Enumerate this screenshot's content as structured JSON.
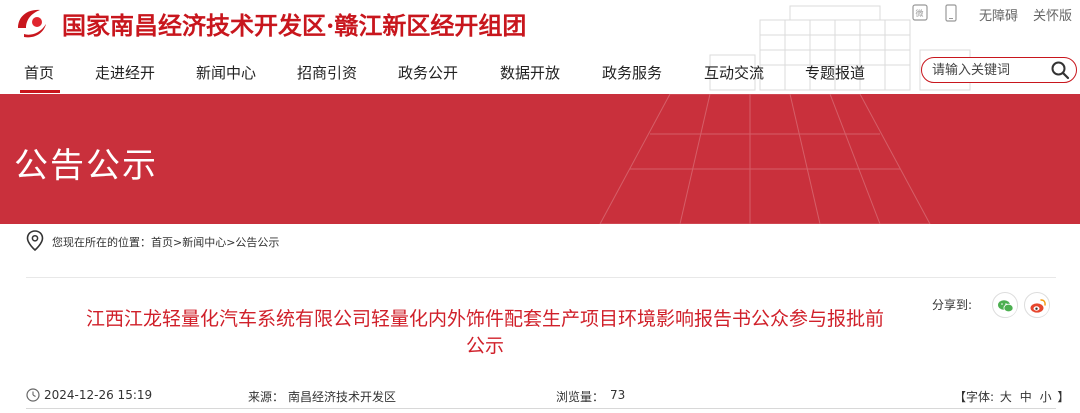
{
  "header": {
    "site_title": "国家南昌经济技术开发区·赣江新区经开组团",
    "utilities": [
      "无障碍",
      "关怀版"
    ],
    "brand_color": "#c8161d",
    "icons": [
      "logo-mark-icon",
      "wechat-qr-icon",
      "mobile-icon"
    ]
  },
  "nav": {
    "items": [
      "首页",
      "走进经开",
      "新闻中心",
      "招商引资",
      "政务公开",
      "数据开放",
      "政务服务",
      "互动交流",
      "专题报道"
    ],
    "active": "首页"
  },
  "search": {
    "placeholder": "请输入关键词",
    "icon": "search-icon"
  },
  "banner": {
    "title": "公告公示",
    "background": "#c9303c"
  },
  "breadcrumb": {
    "icon": "location-pin-icon",
    "text": "您现在所在的位置：首页>新闻中心>公告公示"
  },
  "article": {
    "title_line1": "江西江龙轻量化汽车系统有限公司轻量化内外饰件配套生产项目环境影响报告书公众参与报批前",
    "title_line2": "公示",
    "title_color": "#d0202a",
    "share_label": "分享到:",
    "share_icons": [
      "wechat-share-icon",
      "weibo-share-icon"
    ],
    "date": "2024-12-26 15:19",
    "source_label": "来源：",
    "source": "南昌经济技术开发区",
    "views_label": "浏览量：",
    "views": "73",
    "font_label": "【字体:",
    "font_options": [
      "大",
      "中",
      "小"
    ],
    "font_close": "】"
  }
}
